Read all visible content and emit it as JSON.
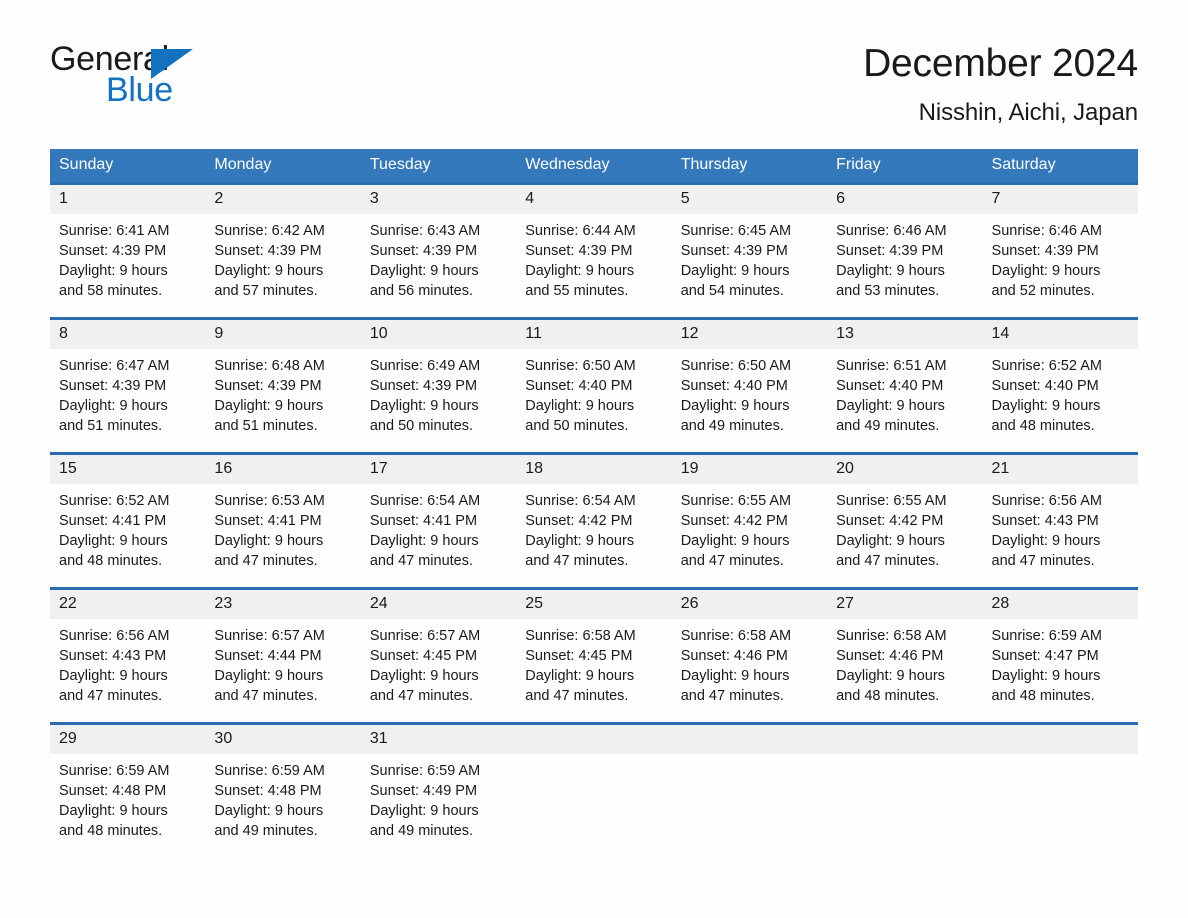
{
  "brand": {
    "name_part1": "General",
    "name_part2": "Blue",
    "logo_icon": "triangle-logo-icon",
    "accent_color": "#1272c0"
  },
  "header": {
    "title": "December 2024",
    "location": "Nisshin, Aichi, Japan"
  },
  "calendar": {
    "header_bg": "#3478bc",
    "row_border_color": "#2b6cb0",
    "daynum_bg": "#f0f0f0",
    "weekdays": [
      "Sunday",
      "Monday",
      "Tuesday",
      "Wednesday",
      "Thursday",
      "Friday",
      "Saturday"
    ],
    "weeks": [
      [
        {
          "day": "1",
          "sunrise": "Sunrise: 6:41 AM",
          "sunset": "Sunset: 4:39 PM",
          "daylight1": "Daylight: 9 hours",
          "daylight2": "and 58 minutes."
        },
        {
          "day": "2",
          "sunrise": "Sunrise: 6:42 AM",
          "sunset": "Sunset: 4:39 PM",
          "daylight1": "Daylight: 9 hours",
          "daylight2": "and 57 minutes."
        },
        {
          "day": "3",
          "sunrise": "Sunrise: 6:43 AM",
          "sunset": "Sunset: 4:39 PM",
          "daylight1": "Daylight: 9 hours",
          "daylight2": "and 56 minutes."
        },
        {
          "day": "4",
          "sunrise": "Sunrise: 6:44 AM",
          "sunset": "Sunset: 4:39 PM",
          "daylight1": "Daylight: 9 hours",
          "daylight2": "and 55 minutes."
        },
        {
          "day": "5",
          "sunrise": "Sunrise: 6:45 AM",
          "sunset": "Sunset: 4:39 PM",
          "daylight1": "Daylight: 9 hours",
          "daylight2": "and 54 minutes."
        },
        {
          "day": "6",
          "sunrise": "Sunrise: 6:46 AM",
          "sunset": "Sunset: 4:39 PM",
          "daylight1": "Daylight: 9 hours",
          "daylight2": "and 53 minutes."
        },
        {
          "day": "7",
          "sunrise": "Sunrise: 6:46 AM",
          "sunset": "Sunset: 4:39 PM",
          "daylight1": "Daylight: 9 hours",
          "daylight2": "and 52 minutes."
        }
      ],
      [
        {
          "day": "8",
          "sunrise": "Sunrise: 6:47 AM",
          "sunset": "Sunset: 4:39 PM",
          "daylight1": "Daylight: 9 hours",
          "daylight2": "and 51 minutes."
        },
        {
          "day": "9",
          "sunrise": "Sunrise: 6:48 AM",
          "sunset": "Sunset: 4:39 PM",
          "daylight1": "Daylight: 9 hours",
          "daylight2": "and 51 minutes."
        },
        {
          "day": "10",
          "sunrise": "Sunrise: 6:49 AM",
          "sunset": "Sunset: 4:39 PM",
          "daylight1": "Daylight: 9 hours",
          "daylight2": "and 50 minutes."
        },
        {
          "day": "11",
          "sunrise": "Sunrise: 6:50 AM",
          "sunset": "Sunset: 4:40 PM",
          "daylight1": "Daylight: 9 hours",
          "daylight2": "and 50 minutes."
        },
        {
          "day": "12",
          "sunrise": "Sunrise: 6:50 AM",
          "sunset": "Sunset: 4:40 PM",
          "daylight1": "Daylight: 9 hours",
          "daylight2": "and 49 minutes."
        },
        {
          "day": "13",
          "sunrise": "Sunrise: 6:51 AM",
          "sunset": "Sunset: 4:40 PM",
          "daylight1": "Daylight: 9 hours",
          "daylight2": "and 49 minutes."
        },
        {
          "day": "14",
          "sunrise": "Sunrise: 6:52 AM",
          "sunset": "Sunset: 4:40 PM",
          "daylight1": "Daylight: 9 hours",
          "daylight2": "and 48 minutes."
        }
      ],
      [
        {
          "day": "15",
          "sunrise": "Sunrise: 6:52 AM",
          "sunset": "Sunset: 4:41 PM",
          "daylight1": "Daylight: 9 hours",
          "daylight2": "and 48 minutes."
        },
        {
          "day": "16",
          "sunrise": "Sunrise: 6:53 AM",
          "sunset": "Sunset: 4:41 PM",
          "daylight1": "Daylight: 9 hours",
          "daylight2": "and 47 minutes."
        },
        {
          "day": "17",
          "sunrise": "Sunrise: 6:54 AM",
          "sunset": "Sunset: 4:41 PM",
          "daylight1": "Daylight: 9 hours",
          "daylight2": "and 47 minutes."
        },
        {
          "day": "18",
          "sunrise": "Sunrise: 6:54 AM",
          "sunset": "Sunset: 4:42 PM",
          "daylight1": "Daylight: 9 hours",
          "daylight2": "and 47 minutes."
        },
        {
          "day": "19",
          "sunrise": "Sunrise: 6:55 AM",
          "sunset": "Sunset: 4:42 PM",
          "daylight1": "Daylight: 9 hours",
          "daylight2": "and 47 minutes."
        },
        {
          "day": "20",
          "sunrise": "Sunrise: 6:55 AM",
          "sunset": "Sunset: 4:42 PM",
          "daylight1": "Daylight: 9 hours",
          "daylight2": "and 47 minutes."
        },
        {
          "day": "21",
          "sunrise": "Sunrise: 6:56 AM",
          "sunset": "Sunset: 4:43 PM",
          "daylight1": "Daylight: 9 hours",
          "daylight2": "and 47 minutes."
        }
      ],
      [
        {
          "day": "22",
          "sunrise": "Sunrise: 6:56 AM",
          "sunset": "Sunset: 4:43 PM",
          "daylight1": "Daylight: 9 hours",
          "daylight2": "and 47 minutes."
        },
        {
          "day": "23",
          "sunrise": "Sunrise: 6:57 AM",
          "sunset": "Sunset: 4:44 PM",
          "daylight1": "Daylight: 9 hours",
          "daylight2": "and 47 minutes."
        },
        {
          "day": "24",
          "sunrise": "Sunrise: 6:57 AM",
          "sunset": "Sunset: 4:45 PM",
          "daylight1": "Daylight: 9 hours",
          "daylight2": "and 47 minutes."
        },
        {
          "day": "25",
          "sunrise": "Sunrise: 6:58 AM",
          "sunset": "Sunset: 4:45 PM",
          "daylight1": "Daylight: 9 hours",
          "daylight2": "and 47 minutes."
        },
        {
          "day": "26",
          "sunrise": "Sunrise: 6:58 AM",
          "sunset": "Sunset: 4:46 PM",
          "daylight1": "Daylight: 9 hours",
          "daylight2": "and 47 minutes."
        },
        {
          "day": "27",
          "sunrise": "Sunrise: 6:58 AM",
          "sunset": "Sunset: 4:46 PM",
          "daylight1": "Daylight: 9 hours",
          "daylight2": "and 48 minutes."
        },
        {
          "day": "28",
          "sunrise": "Sunrise: 6:59 AM",
          "sunset": "Sunset: 4:47 PM",
          "daylight1": "Daylight: 9 hours",
          "daylight2": "and 48 minutes."
        }
      ],
      [
        {
          "day": "29",
          "sunrise": "Sunrise: 6:59 AM",
          "sunset": "Sunset: 4:48 PM",
          "daylight1": "Daylight: 9 hours",
          "daylight2": "and 48 minutes."
        },
        {
          "day": "30",
          "sunrise": "Sunrise: 6:59 AM",
          "sunset": "Sunset: 4:48 PM",
          "daylight1": "Daylight: 9 hours",
          "daylight2": "and 49 minutes."
        },
        {
          "day": "31",
          "sunrise": "Sunrise: 6:59 AM",
          "sunset": "Sunset: 4:49 PM",
          "daylight1": "Daylight: 9 hours",
          "daylight2": "and 49 minutes."
        },
        {
          "day": "",
          "sunrise": "",
          "sunset": "",
          "daylight1": "",
          "daylight2": ""
        },
        {
          "day": "",
          "sunrise": "",
          "sunset": "",
          "daylight1": "",
          "daylight2": ""
        },
        {
          "day": "",
          "sunrise": "",
          "sunset": "",
          "daylight1": "",
          "daylight2": ""
        },
        {
          "day": "",
          "sunrise": "",
          "sunset": "",
          "daylight1": "",
          "daylight2": ""
        }
      ]
    ]
  }
}
